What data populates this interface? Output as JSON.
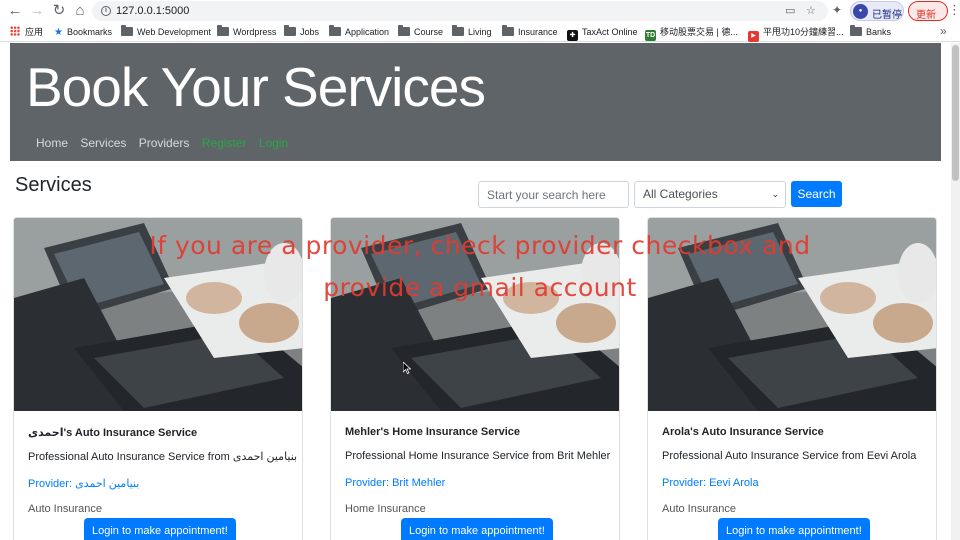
{
  "browser": {
    "url": "127.0.0.1:5000",
    "profile_label": "已暂停",
    "update_label": "更新",
    "bookmarks": [
      {
        "label": "应用",
        "icon": "apps-grid-icon"
      },
      {
        "label": "Bookmarks",
        "icon": "star-icon"
      },
      {
        "label": "Web Development",
        "icon": "folder-icon"
      },
      {
        "label": "Wordpress",
        "icon": "folder-icon"
      },
      {
        "label": "Jobs",
        "icon": "folder-icon"
      },
      {
        "label": "Application",
        "icon": "folder-icon"
      },
      {
        "label": "Course",
        "icon": "folder-icon"
      },
      {
        "label": "Living",
        "icon": "folder-icon"
      },
      {
        "label": "Insurance",
        "icon": "folder-icon"
      },
      {
        "label": "TaxAct Online",
        "icon": "taxact-icon"
      },
      {
        "label": "移动股票交易 | 德...",
        "icon": "td-icon"
      },
      {
        "label": "平甩功10分鐘練習...",
        "icon": "youtube-icon"
      },
      {
        "label": "Banks",
        "icon": "folder-icon"
      }
    ]
  },
  "header": {
    "title": "Book Your Services",
    "nav": [
      "Home",
      "Services",
      "Providers",
      "Register",
      "Login"
    ]
  },
  "toolbar": {
    "heading": "Services",
    "search_placeholder": "Start your search here",
    "category_selected": "All Categories",
    "search_button": "Search"
  },
  "cards": [
    {
      "title": "احمدی's Auto Insurance Service",
      "description": "Professional Auto Insurance Service from بنیامین احمدی",
      "provider": "Provider: بنیامین احمدی",
      "category": "Auto Insurance",
      "button": "Login to make appointment!"
    },
    {
      "title": "Mehler's Home Insurance Service",
      "description": "Professional Home Insurance Service from Brit Mehler",
      "provider": "Provider: Brit Mehler",
      "category": "Home Insurance",
      "button": "Login to make appointment!"
    },
    {
      "title": "Arola's Auto Insurance Service",
      "description": "Professional Auto Insurance Service from Eevi Arola",
      "provider": "Provider: Eevi Arola",
      "category": "Auto Insurance",
      "button": "Login to make appointment!"
    }
  ],
  "overlay": {
    "line1": "If you are a provider, check provider checkbox and",
    "line2": "provide a gmail account"
  },
  "colors": {
    "jumbotron": "#5f6469",
    "primary": "#007bff",
    "nav_active": "#28a745",
    "caption": "#e23b30"
  }
}
